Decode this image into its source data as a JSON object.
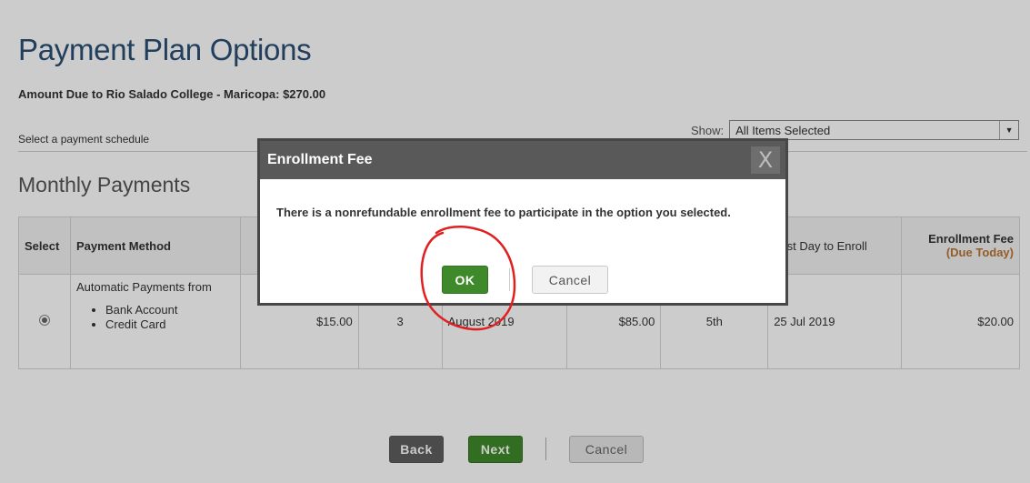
{
  "page": {
    "title": "Payment Plan Options",
    "amount_due": "Amount Due to Rio Salado College - Maricopa: $270.00",
    "select_schedule_label": "Select a payment schedule",
    "show_label": "Show:",
    "show_value": "All Items Selected",
    "section_title": "Monthly Payments"
  },
  "table": {
    "headers": {
      "select": "Select",
      "payment_method": "Payment Method",
      "last_day": "Last Day to Enroll",
      "enrollment_fee": "Enrollment Fee",
      "due_today": "(Due Today)"
    },
    "row": {
      "method_title": "Automatic Payments from",
      "method_options": [
        "Bank Account",
        "Credit Card"
      ],
      "amount": "$15.00",
      "count": "3",
      "start": "August 2019",
      "payment": "$85.00",
      "due_day": "5th",
      "last_day": "25 Jul 2019",
      "fee": "$20.00"
    }
  },
  "buttons": {
    "back": "Back",
    "next": "Next",
    "cancel": "Cancel"
  },
  "modal": {
    "title": "Enrollment Fee",
    "close": "X",
    "message": "There is a nonrefundable enrollment fee to participate in the option you selected.",
    "ok": "OK",
    "cancel": "Cancel"
  },
  "colors": {
    "title": "#2a4f73",
    "next_green": "#3e8a2a",
    "modal_header": "#595959",
    "annotation_red": "#e02020"
  }
}
